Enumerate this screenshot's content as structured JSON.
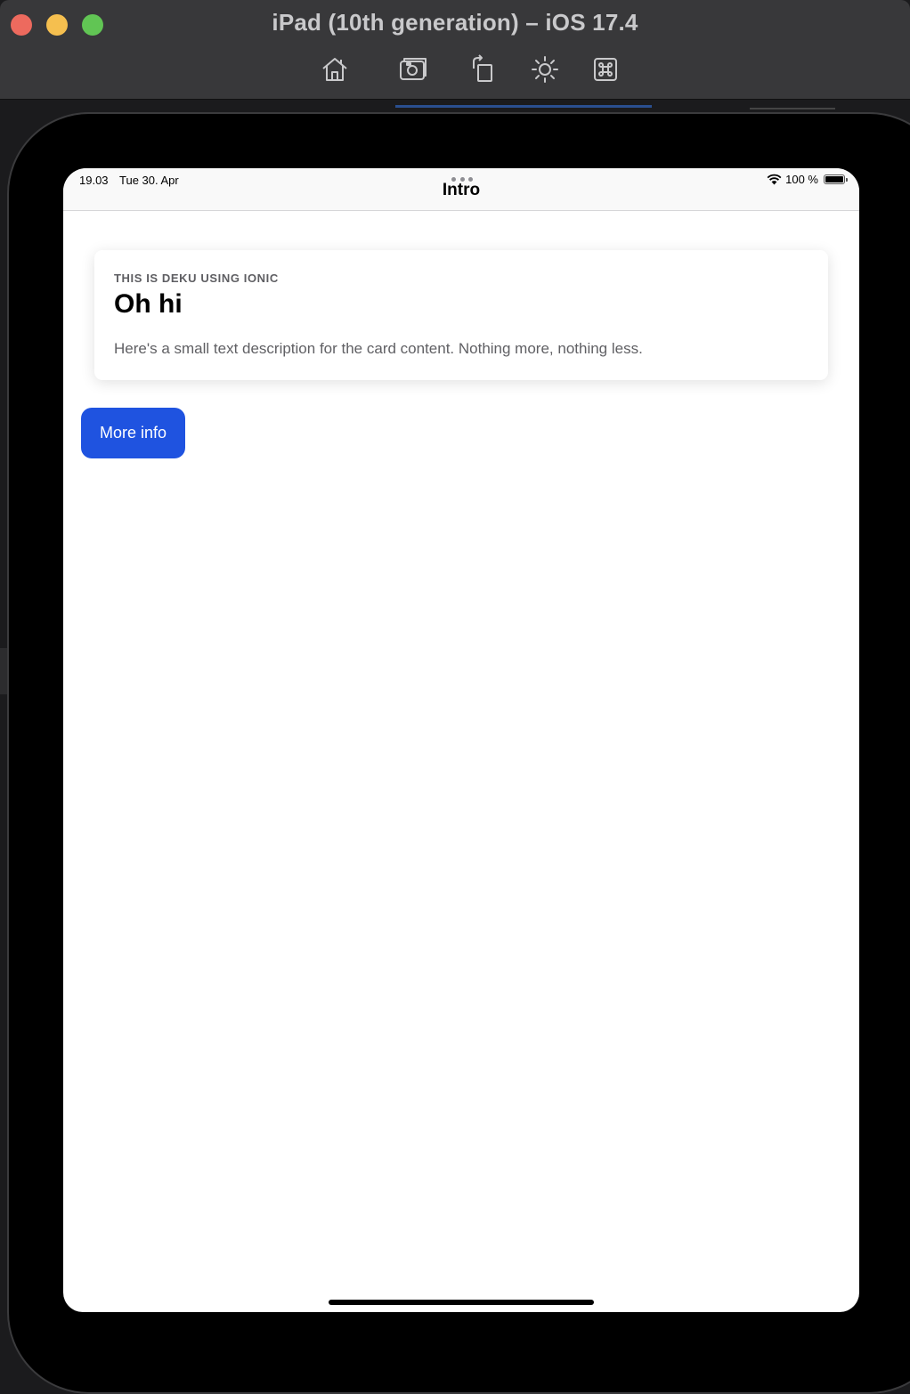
{
  "window": {
    "title": "iPad (10th generation) – iOS 17.4",
    "toolbar": [
      {
        "icon": "home-icon"
      },
      {
        "icon": "screenshot-icon"
      },
      {
        "icon": "rotate-icon"
      },
      {
        "icon": "appearance-icon"
      },
      {
        "icon": "command-icon"
      }
    ]
  },
  "status_bar": {
    "time": "19.03",
    "date": "Tue 30. Apr",
    "battery": "100 %"
  },
  "header": {
    "title": "Intro"
  },
  "card": {
    "subtitle": "THIS IS DEKU USING IONIC",
    "title": "Oh hi",
    "content": "Here's a small text description for the card content. Nothing more, nothing less."
  },
  "button": {
    "label": "More info"
  },
  "colors": {
    "primary": "#1f53e0",
    "window_bar": "#38383a",
    "close": "#ed6a5e",
    "minimize": "#f5bf4f",
    "maximize": "#61c554"
  }
}
